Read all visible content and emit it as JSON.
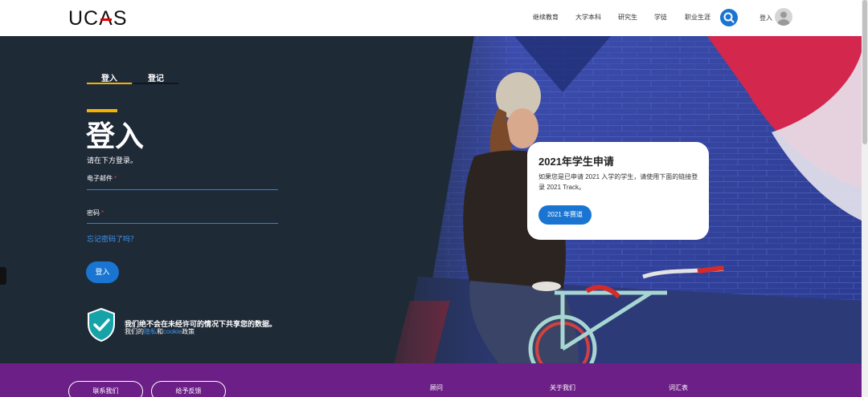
{
  "header": {
    "logo": "UCAS",
    "nav": [
      "继续教育",
      "大学本科",
      "研究生",
      "学徒",
      "职业生涯"
    ],
    "signin_label": "登入"
  },
  "login": {
    "tabs": [
      "登入",
      "登记"
    ],
    "title": "登入",
    "subtitle": "请在下方登录。",
    "email_label": "电子邮件",
    "password_label": "密码",
    "required_mark": "*",
    "forgot_link": "忘记密码了吗？",
    "submit_label": "登入",
    "privacy_statement": "我们绝不会在未经许可的情况下共享您的数据。",
    "privacy_prefix": "我们的",
    "privacy_link": "隐私",
    "privacy_and": "和",
    "cookie_link": "cookie",
    "privacy_suffix": "政策"
  },
  "card": {
    "title": "2021年学生申请",
    "text": "如果您是已申请 2021 入学的学生，请使用下面的链接登录 2021 Track。",
    "button_label": "2021 年赛道"
  },
  "footer": {
    "buttons": [
      "联系我们",
      "给予反馈"
    ],
    "links": [
      "顾问",
      "关于我们",
      "词汇表"
    ]
  },
  "colors": {
    "accent_blue": "#1a75d2",
    "hero_dark": "#1f2a37",
    "footer_purple": "#6c1f87",
    "title_underline": "#f5b301"
  }
}
